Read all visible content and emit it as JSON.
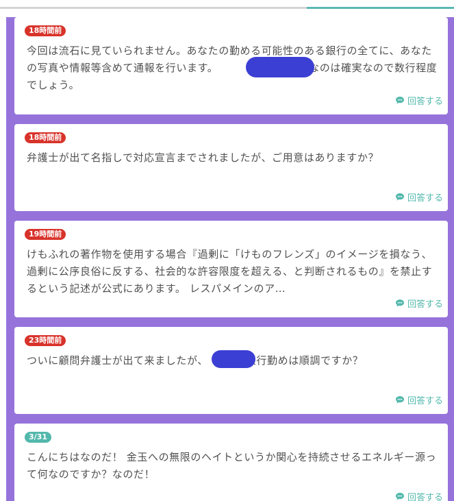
{
  "progress": {
    "fraction": 0.32
  },
  "colors": {
    "accent": "#53b8ac",
    "badge_red": "#d8332b",
    "badge_teal": "#53b8ac",
    "frame": "#9673db",
    "redaction": "#3c3fd3"
  },
  "icons": {
    "answer": "comment-icon"
  },
  "feed": {
    "items": [
      {
        "time": "18時間前",
        "badge_color": "red",
        "text": "今回は流石に見ていられません。あなたの勤める可能性のある銀行の全てに、あなたの写真や情報等含めて通報を行います。　　　　　　　地域なのは確実なので数行程度でしょう。",
        "answer_label": "回答する"
      },
      {
        "time": "18時間前",
        "badge_color": "red",
        "text": "弁護士が出て名指しで対応宣言までされましたが、ご用意はありますか？",
        "answer_label": "回答する"
      },
      {
        "time": "19時間前",
        "badge_color": "red",
        "text": "けもふれの著作物を使用する場合『過剰に「けものフレンズ」のイメージを損なう、過剰に公序良俗に反する、社会的な許容限度を超える、と判断されるもの』を禁止するという記述が公式にあります。 レスパメインのア…",
        "answer_label": "回答する"
      },
      {
        "time": "23時間前",
        "badge_color": "red",
        "text": "ついに顧問弁護士が出て来ましたが、　　　　銀行勤めは順調ですか？",
        "answer_label": "回答する"
      },
      {
        "time": "3/31",
        "badge_color": "teal",
        "text": "こんにちはなのだ！ 金玉への無限のヘイトというか関心を持続させるエネルギー源って何なのですか？なのだ！",
        "answer_label": "回答する"
      }
    ]
  }
}
